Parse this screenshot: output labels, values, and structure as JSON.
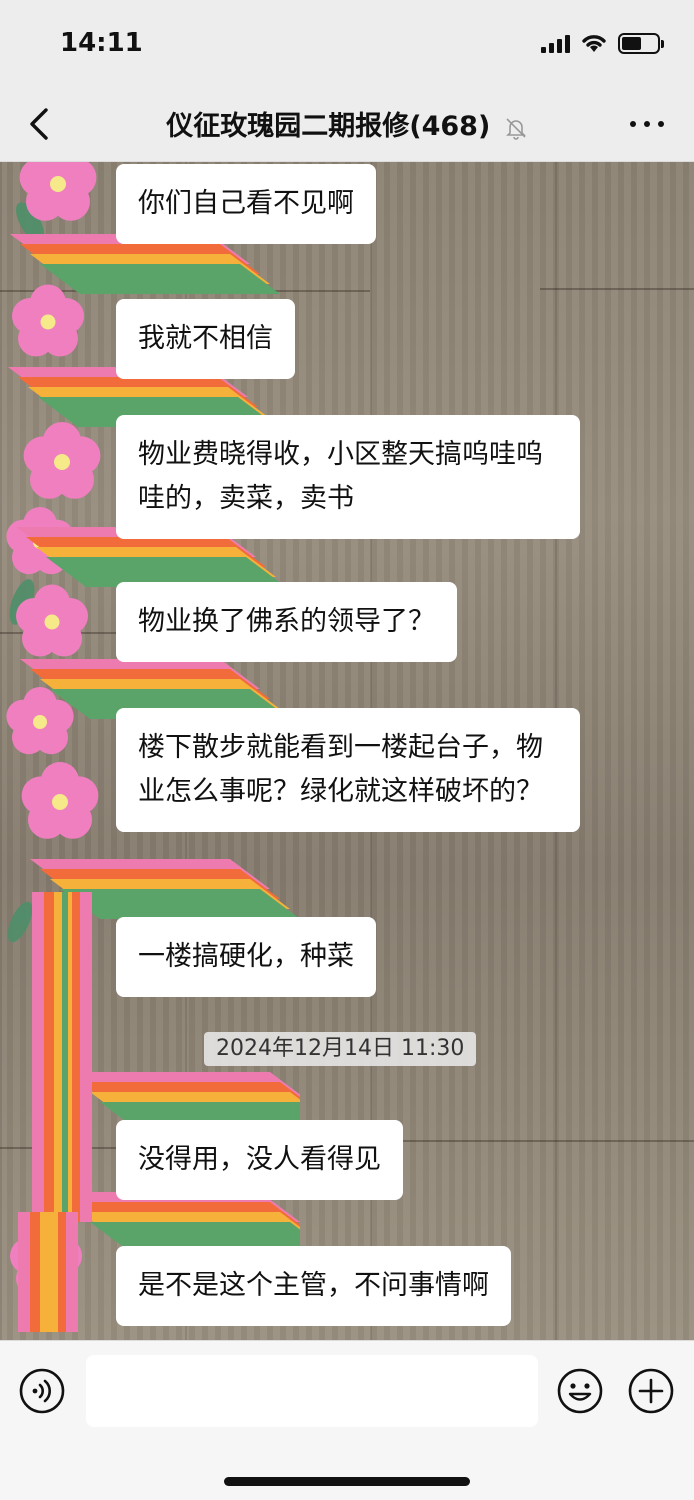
{
  "status_bar": {
    "time": "14:11"
  },
  "nav": {
    "title": "仪征玫瑰园二期报修(468)",
    "icons": [
      "back-icon",
      "mute-bell-icon",
      "more-icon"
    ]
  },
  "messages": [
    {
      "text": "你们自己看不见啊"
    },
    {
      "text": "我就不相信"
    },
    {
      "text": "物业费晓得收，小区整天搞呜哇呜哇的，卖菜，卖书"
    },
    {
      "text": "物业换了佛系的领导了？"
    },
    {
      "text": "楼下散步就能看到一楼起台子，物业怎么事呢？绿化就这样破坏的？"
    },
    {
      "text": "一楼搞硬化，种菜"
    },
    {
      "text": "没得用，没人看得见"
    },
    {
      "text": "是不是这个主管，不问事情啊"
    }
  ],
  "timestamp": "2024年12月14日 11:30",
  "input_bar": {
    "placeholder": "",
    "icons": [
      "voice-icon",
      "emoji-icon",
      "plus-icon"
    ]
  },
  "colors": {
    "bar_bg": "#ededed",
    "bubble_bg": "#ffffff",
    "ribbon": [
      "#ee7bb0",
      "#f26b3a",
      "#f5b13a",
      "#5aa469"
    ],
    "flower": "#f07fc0"
  }
}
